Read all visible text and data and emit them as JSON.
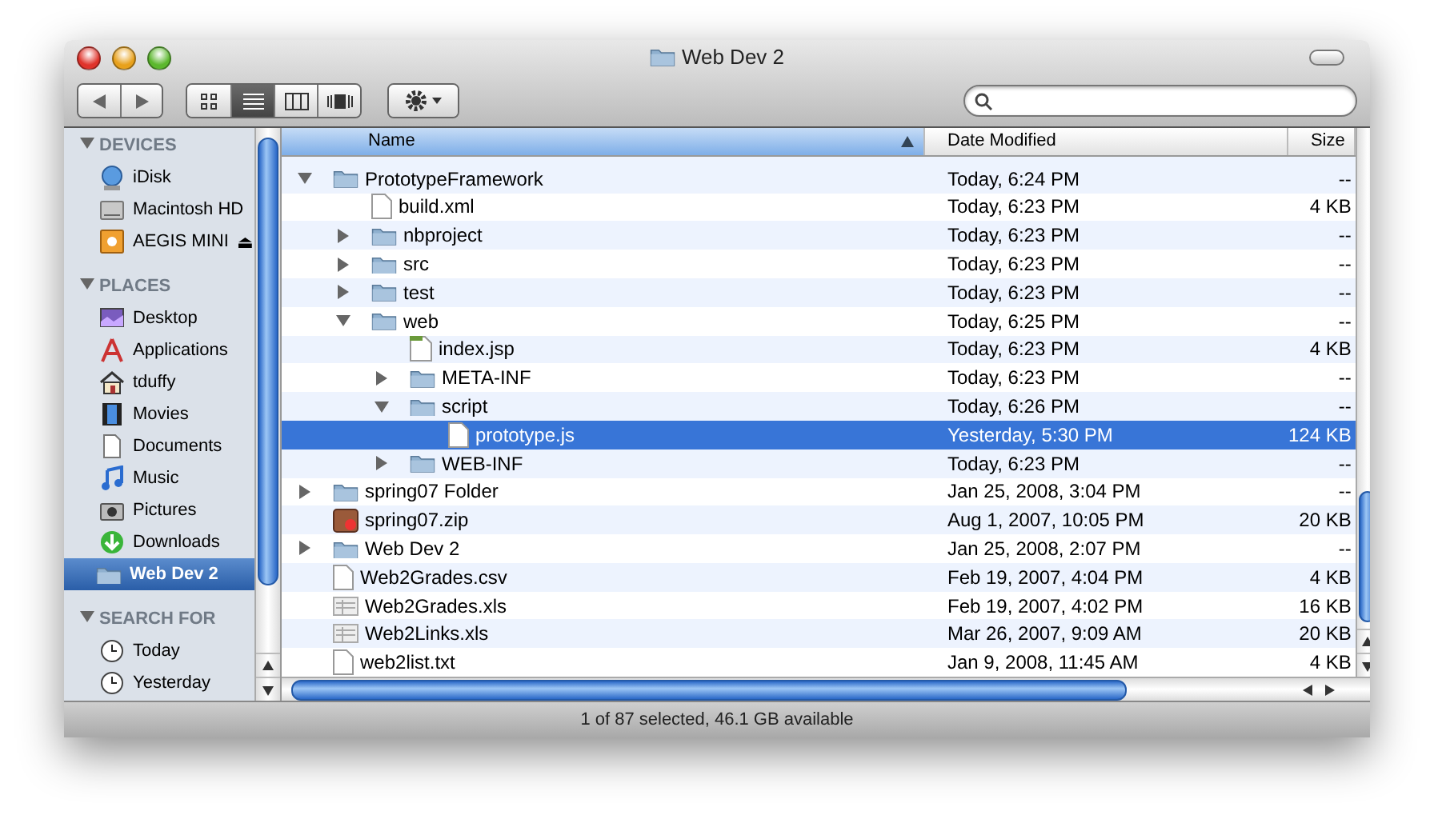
{
  "window": {
    "title": "Web Dev 2"
  },
  "toolbar": {
    "views": [
      {
        "kind": "icons",
        "selected": false
      },
      {
        "kind": "list",
        "selected": true
      },
      {
        "kind": "columns",
        "selected": false
      },
      {
        "kind": "coverflow",
        "selected": false
      }
    ]
  },
  "sidebar": {
    "sections": [
      {
        "title": "DEVICES",
        "expanded": true,
        "items": [
          {
            "label": "iDisk",
            "kind": "idisk",
            "selected": false
          },
          {
            "label": "Macintosh HD",
            "kind": "disk",
            "selected": false
          },
          {
            "label": "AEGIS MINI",
            "kind": "usb",
            "selected": false,
            "eject": "⏏"
          }
        ]
      },
      {
        "title": "PLACES",
        "expanded": true,
        "items": [
          {
            "label": "Desktop",
            "kind": "desktop",
            "selected": false
          },
          {
            "label": "Applications",
            "kind": "apps",
            "selected": false
          },
          {
            "label": "tduffy",
            "kind": "home",
            "selected": false
          },
          {
            "label": "Movies",
            "kind": "movies",
            "selected": false
          },
          {
            "label": "Documents",
            "kind": "docs",
            "selected": false
          },
          {
            "label": "Music",
            "kind": "music",
            "selected": false
          },
          {
            "label": "Pictures",
            "kind": "pictures",
            "selected": false
          },
          {
            "label": "Downloads",
            "kind": "downloads",
            "selected": false
          },
          {
            "label": "Web Dev 2",
            "kind": "folder",
            "selected": true
          }
        ]
      },
      {
        "title": "SEARCH FOR",
        "expanded": true,
        "items": [
          {
            "label": "Today",
            "kind": "clock",
            "selected": false
          },
          {
            "label": "Yesterday",
            "kind": "clock",
            "selected": false
          }
        ]
      }
    ]
  },
  "table": {
    "columns": [
      {
        "label": "Name",
        "sorted": true
      },
      {
        "label": "Date Modified",
        "sorted": false
      },
      {
        "label": "Size",
        "sorted": false
      }
    ],
    "rows": [
      {
        "name": "PrototypeFramework",
        "kind": "folder",
        "expanded": true,
        "date": "Today, 6:24 PM",
        "size": "--",
        "selected": false,
        "children": [
          {
            "name": "build.xml",
            "kind": "file",
            "date": "Today, 6:23 PM",
            "size": "4 KB",
            "selected": false
          },
          {
            "name": "nbproject",
            "kind": "folder",
            "expanded": false,
            "date": "Today, 6:23 PM",
            "size": "--",
            "selected": false
          },
          {
            "name": "src",
            "kind": "folder",
            "expanded": false,
            "date": "Today, 6:23 PM",
            "size": "--",
            "selected": false
          },
          {
            "name": "test",
            "kind": "folder",
            "expanded": false,
            "date": "Today, 6:23 PM",
            "size": "--",
            "selected": false
          },
          {
            "name": "web",
            "kind": "folder",
            "expanded": true,
            "date": "Today, 6:25 PM",
            "size": "--",
            "selected": false,
            "children": [
              {
                "name": "index.jsp",
                "kind": "jsp",
                "date": "Today, 6:23 PM",
                "size": "4 KB",
                "selected": false
              },
              {
                "name": "META-INF",
                "kind": "folder",
                "expanded": false,
                "date": "Today, 6:23 PM",
                "size": "--",
                "selected": false
              },
              {
                "name": "script",
                "kind": "folder",
                "expanded": true,
                "date": "Today, 6:26 PM",
                "size": "--",
                "selected": false,
                "children": [
                  {
                    "name": "prototype.js",
                    "kind": "file",
                    "date": "Yesterday, 5:30 PM",
                    "size": "124 KB",
                    "selected": true
                  }
                ]
              },
              {
                "name": "WEB-INF",
                "kind": "folder",
                "expanded": false,
                "date": "Today, 6:23 PM",
                "size": "--",
                "selected": false
              }
            ]
          }
        ]
      },
      {
        "name": "spring07 Folder",
        "kind": "folder",
        "expanded": false,
        "date": "Jan 25, 2008, 3:04 PM",
        "size": "--",
        "selected": false
      },
      {
        "name": "spring07.zip",
        "kind": "zip",
        "date": "Aug 1, 2007, 10:05 PM",
        "size": "20 KB",
        "selected": false
      },
      {
        "name": "Web Dev 2",
        "kind": "folder",
        "expanded": false,
        "date": "Jan 25, 2008, 2:07 PM",
        "size": "--",
        "selected": false
      },
      {
        "name": "Web2Grades.csv",
        "kind": "file",
        "date": "Feb 19, 2007, 4:04 PM",
        "size": "4 KB",
        "selected": false
      },
      {
        "name": "Web2Grades.xls",
        "kind": "sheet",
        "date": "Feb 19, 2007, 4:02 PM",
        "size": "16 KB",
        "selected": false
      },
      {
        "name": "Web2Links.xls",
        "kind": "sheet",
        "date": "Mar 26, 2007, 9:09 AM",
        "size": "20 KB",
        "selected": false
      },
      {
        "name": "web2list.txt",
        "kind": "file",
        "date": "Jan 9, 2008, 11:45 AM",
        "size": "4 KB",
        "selected": false
      }
    ]
  },
  "status_bar": "1 of 87 selected, 46.1 GB available"
}
